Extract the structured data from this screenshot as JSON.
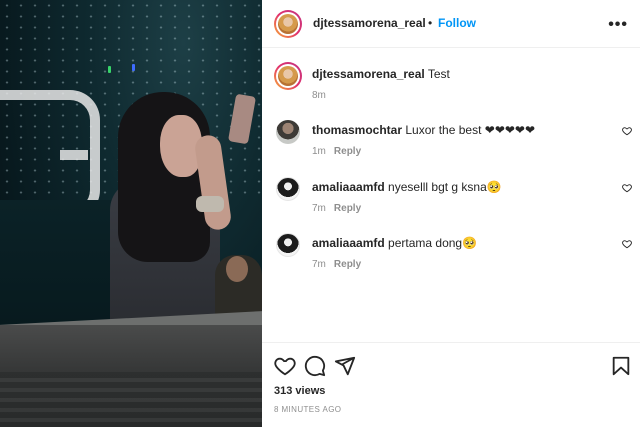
{
  "post": {
    "author": "djtessamorena_real",
    "follow_label": "Follow",
    "separator": "•",
    "more_label": "•••",
    "caption": "Test",
    "caption_time": "8m"
  },
  "comments": [
    {
      "username": "thomasmochtar",
      "text": "Luxor the best ❤❤❤❤❤",
      "time": "1m",
      "reply_label": "Reply",
      "avatar": "avatar-thomas"
    },
    {
      "username": "amaliaaamfd",
      "text": "nyeselll bgt g ksna🥺",
      "time": "7m",
      "reply_label": "Reply",
      "avatar": "avatar-amalia"
    },
    {
      "username": "amaliaaamfd",
      "text": "pertama dong🥺",
      "time": "7m",
      "reply_label": "Reply",
      "avatar": "avatar-amalia"
    }
  ],
  "actions": {
    "icons": [
      "heart-icon",
      "comment-icon",
      "share-icon",
      "bookmark-icon"
    ],
    "views": "313 views",
    "time_ago": "8 MINUTES AGO"
  },
  "colors": {
    "accent": "#0095f6",
    "text": "#262626",
    "muted": "#8e8e8e",
    "divider": "#efefef"
  }
}
